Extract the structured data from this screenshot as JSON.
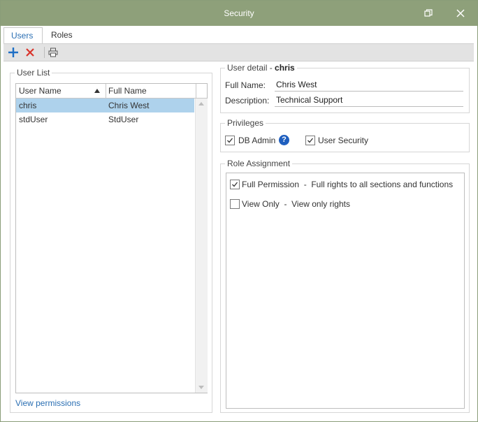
{
  "window": {
    "title": "Security"
  },
  "titlebar": {
    "restore_icon": "restore-icon",
    "close_icon": "close-icon"
  },
  "tabs": [
    {
      "label": "Users",
      "active": true
    },
    {
      "label": "Roles",
      "active": false
    }
  ],
  "toolbar": {
    "add_icon": "plus-icon",
    "delete_icon": "x-icon",
    "print_icon": "printer-icon"
  },
  "user_list": {
    "legend": "User List",
    "columns": [
      {
        "label": "User Name",
        "sort": "ascending"
      },
      {
        "label": "Full Name"
      }
    ],
    "rows": [
      {
        "user_name": "chris",
        "full_name": "Chris West",
        "selected": true
      },
      {
        "user_name": "stdUser",
        "full_name": "StdUser",
        "selected": false
      }
    ],
    "view_permissions_link": "View permissions"
  },
  "user_detail": {
    "legend": "User detail -",
    "username": "chris",
    "full_name_label": "Full Name:",
    "full_name_value": "Chris West",
    "description_label": "Description:",
    "description_value": "Technical Support"
  },
  "privileges": {
    "legend": "Privileges",
    "items": [
      {
        "label": "DB Admin",
        "checked": true
      },
      {
        "label": "User Security",
        "checked": true
      }
    ]
  },
  "role_assignment": {
    "legend": "Role Assignment",
    "roles": [
      {
        "label": "Full Permission  -  Full rights to all sections and functions",
        "checked": true
      },
      {
        "label": "View Only  -  View only rights",
        "checked": false
      }
    ]
  },
  "colors": {
    "titlebar": "#8ea07a",
    "accent": "#2b6fb3",
    "selection": "#aed2ec",
    "delete": "#d9342b"
  }
}
